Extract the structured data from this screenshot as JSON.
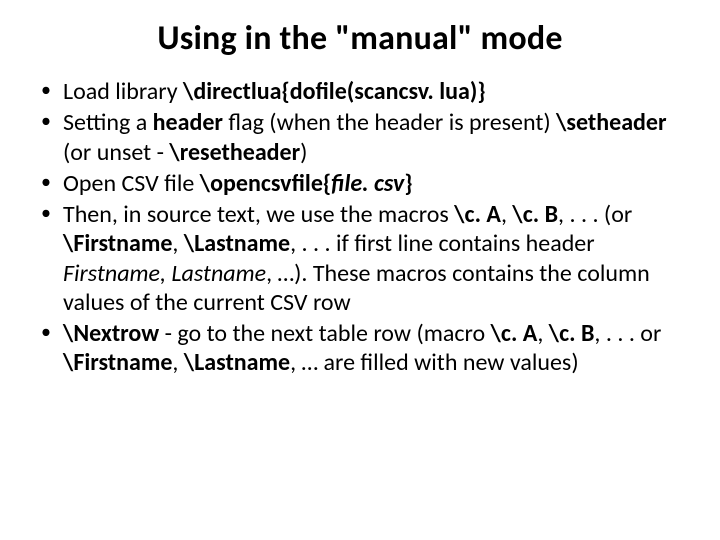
{
  "title": "Using in the \"manual\" mode",
  "bullets": {
    "b1_t1": "Load library ",
    "b1_t2": "\\directlua{dofile(scancsv. lua)}",
    "b2_t1": "Setting a ",
    "b2_t2": "header",
    "b2_t3": " flag (when the header is present) ",
    "b2_t4": "\\setheader",
    "b2_t5": " (or unset - ",
    "b2_t6": "\\resetheader",
    "b2_t7": ")",
    "b3_t1": "Open CSV file ",
    "b3_t2": "\\opencsvfile{",
    "b3_t3": "file. csv",
    "b3_t4": "}",
    "b4_t1": "Then, in source text, we use the macros ",
    "b4_t2": "\\c. A",
    "b4_t3": ", ",
    "b4_t4": "\\c. B",
    "b4_t5": ", ",
    "b4_t6": ". . .",
    "b4_t7": " (or ",
    "b4_t8": "\\Firstname",
    "b4_t9": ", ",
    "b4_t10": "\\Lastname",
    "b4_t11": ", ",
    "b4_t12": ". . .",
    "b4_t13": " if first line contains  header ",
    "b4_t14": "Firstname",
    "b4_t15": ", ",
    "b4_t16": "Lastname",
    "b4_t17": ", …). These macros contains the column values of the current CSV row",
    "b5_t1": "\\Nextrow",
    "b5_t2": " - go to the next table row (macro ",
    "b5_t3": "\\c. A",
    "b5_t4": ", ",
    "b5_t5": "\\c. B",
    "b5_t6": ", ",
    "b5_t7": ". . .",
    "b5_t8": " or ",
    "b5_t9": "\\Firstname",
    "b5_t10": ", ",
    "b5_t11": "\\Lastname",
    "b5_t12": ", … are filled with new values)"
  }
}
